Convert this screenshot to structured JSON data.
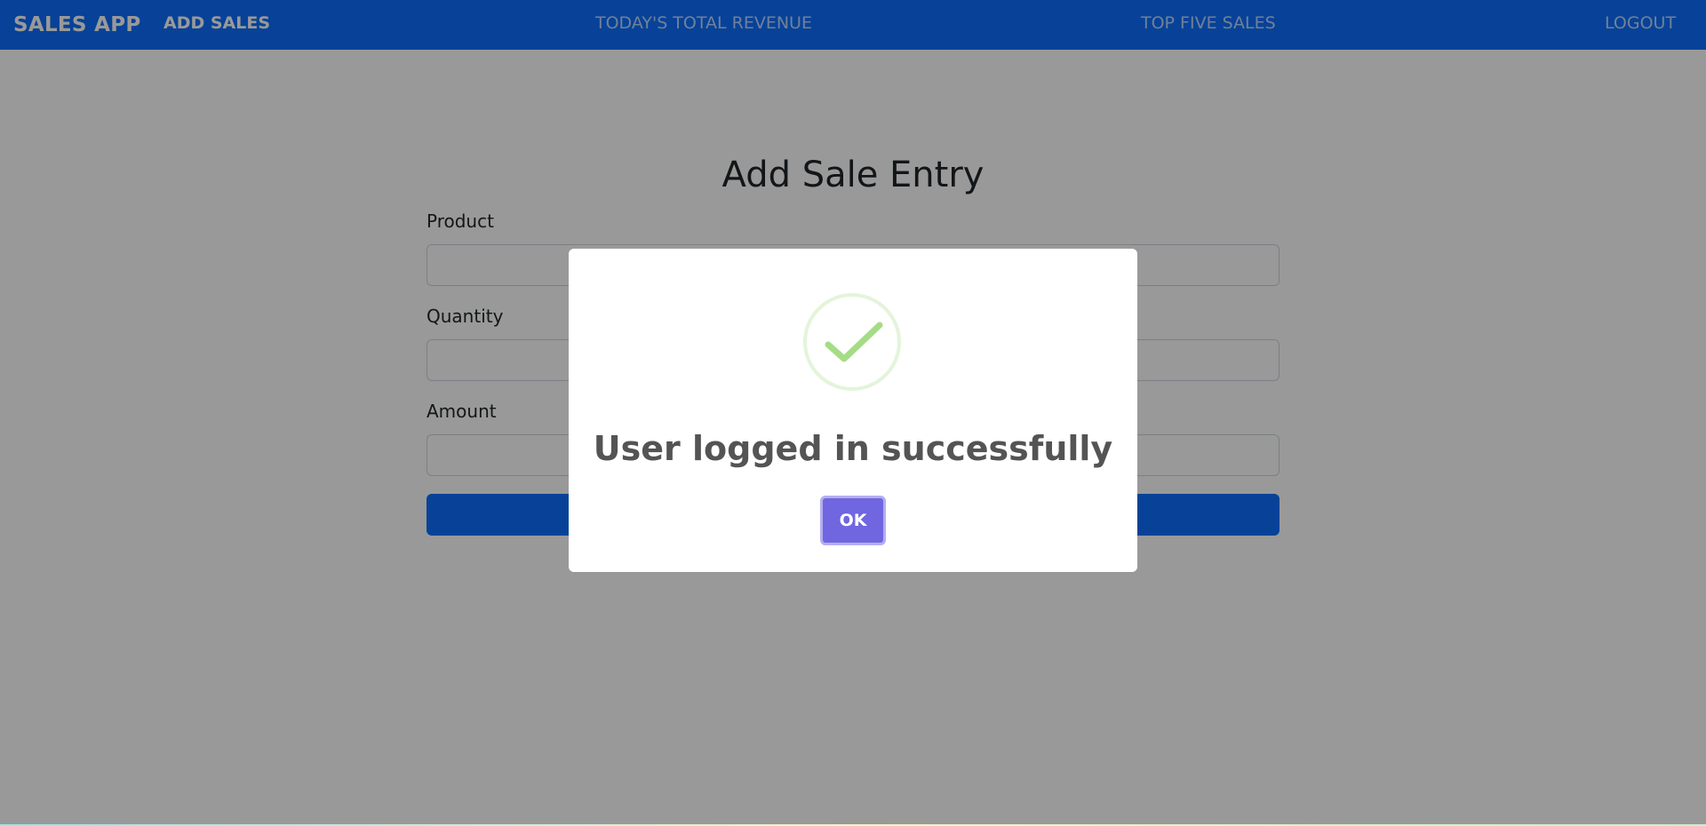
{
  "navbar": {
    "brand": "SALES APP",
    "links": {
      "add_sales": "ADD SALES",
      "todays_revenue": "TODAY'S TOTAL REVENUE",
      "top_five": "TOP FIVE SALES",
      "logout": "LOGOUT"
    },
    "color": "#0d6efd"
  },
  "form": {
    "title": "Add Sale Entry",
    "product_label": "Product",
    "quantity_label": "Quantity",
    "amount_label": "Amount",
    "product_value": "",
    "quantity_value": "",
    "amount_value": ""
  },
  "modal": {
    "icon": "success-check-icon",
    "title": "User logged in successfully",
    "ok_label": "OK",
    "button_color": "#7066e0"
  }
}
